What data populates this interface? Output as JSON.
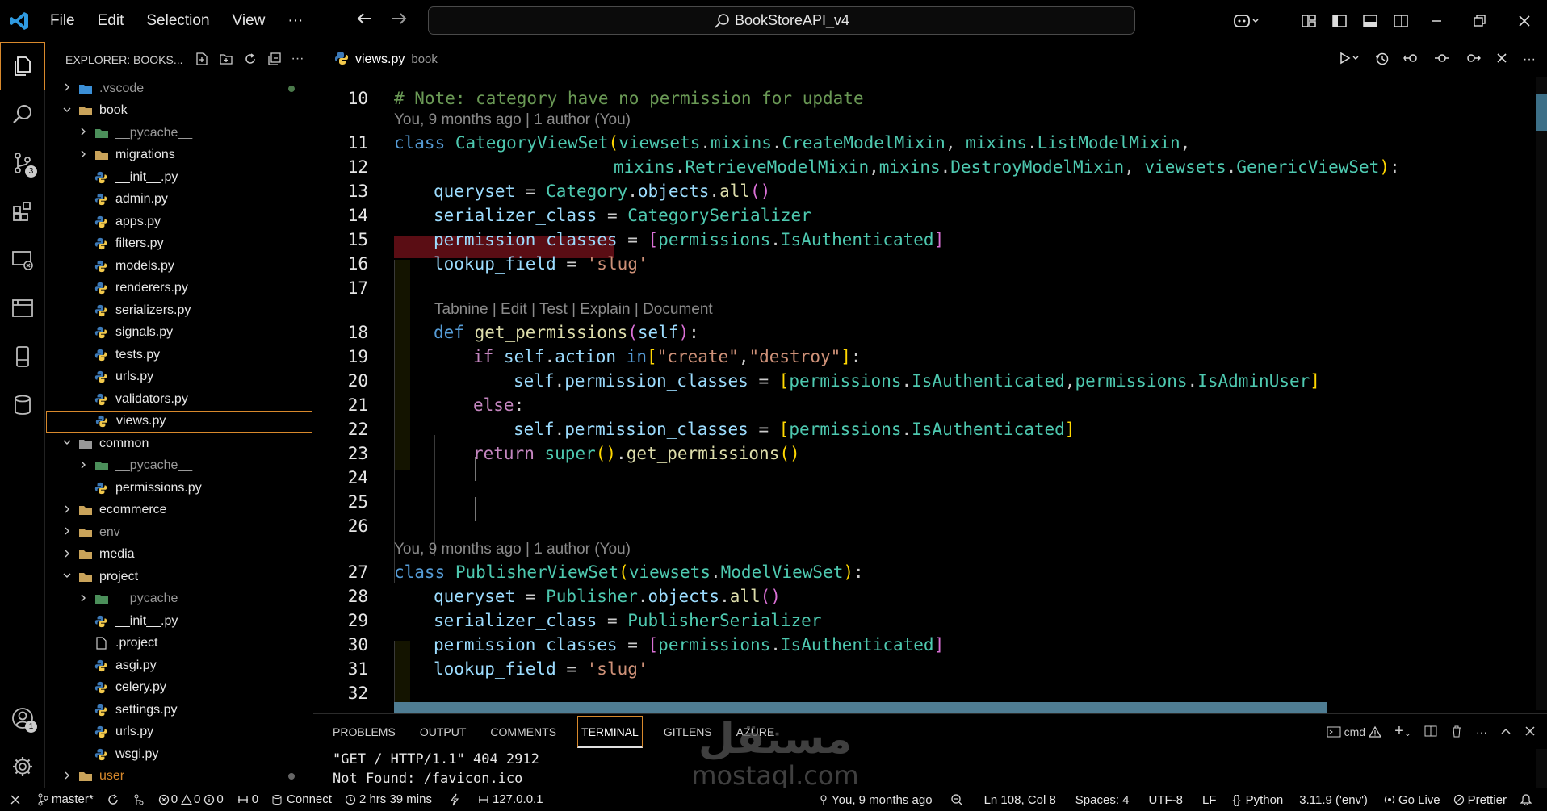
{
  "titlebar": {
    "menu": [
      "File",
      "Edit",
      "Selection",
      "View",
      "···"
    ],
    "search_text": "BookStoreAPI_v4"
  },
  "explorer": {
    "header": "EXPLORER: BOOKS...",
    "items": [
      {
        "label": ".vscode",
        "type": "folder",
        "state": "collapsed",
        "special": "vscode",
        "level": 0
      },
      {
        "label": "book",
        "type": "folder",
        "state": "expanded",
        "level": 0
      },
      {
        "label": "__pycache__",
        "type": "folder",
        "state": "collapsed",
        "special": "pycache",
        "level": 1
      },
      {
        "label": "migrations",
        "type": "folder",
        "state": "collapsed",
        "level": 1
      },
      {
        "label": "__init__.py",
        "type": "python",
        "level": 1
      },
      {
        "label": "admin.py",
        "type": "python",
        "level": 1
      },
      {
        "label": "apps.py",
        "type": "python",
        "level": 1
      },
      {
        "label": "filters.py",
        "type": "python",
        "level": 1
      },
      {
        "label": "models.py",
        "type": "python",
        "level": 1
      },
      {
        "label": "renderers.py",
        "type": "python",
        "level": 1
      },
      {
        "label": "serializers.py",
        "type": "python",
        "level": 1
      },
      {
        "label": "signals.py",
        "type": "python",
        "level": 1
      },
      {
        "label": "tests.py",
        "type": "python",
        "level": 1
      },
      {
        "label": "urls.py",
        "type": "python",
        "level": 1
      },
      {
        "label": "validators.py",
        "type": "python",
        "level": 1
      },
      {
        "label": "views.py",
        "type": "python",
        "level": 1,
        "selected": true
      },
      {
        "label": "common",
        "type": "folder",
        "state": "expanded",
        "special": "common",
        "level": 0
      },
      {
        "label": "__pycache__",
        "type": "folder",
        "state": "collapsed",
        "special": "pycache",
        "level": 1
      },
      {
        "label": "permissions.py",
        "type": "python",
        "level": 1
      },
      {
        "label": "ecommerce",
        "type": "folder",
        "state": "collapsed",
        "level": 0
      },
      {
        "label": "env",
        "type": "folder",
        "state": "collapsed",
        "level": 0,
        "dim": true
      },
      {
        "label": "media",
        "type": "folder",
        "state": "collapsed",
        "level": 0
      },
      {
        "label": "project",
        "type": "folder",
        "state": "expanded",
        "level": 0
      },
      {
        "label": "__pycache__",
        "type": "folder",
        "state": "collapsed",
        "special": "pycache",
        "level": 1
      },
      {
        "label": "__init__.py",
        "type": "python",
        "level": 1
      },
      {
        "label": ".project",
        "type": "file",
        "level": 1
      },
      {
        "label": "asgi.py",
        "type": "python",
        "level": 1
      },
      {
        "label": "celery.py",
        "type": "python",
        "level": 1
      },
      {
        "label": "settings.py",
        "type": "python",
        "level": 1
      },
      {
        "label": "urls.py",
        "type": "python",
        "level": 1
      },
      {
        "label": "wsgi.py",
        "type": "python",
        "level": 1
      },
      {
        "label": "user",
        "type": "folder",
        "state": "collapsed",
        "level": 0,
        "orange": true
      }
    ]
  },
  "editor": {
    "tab_name": "views.py",
    "tab_folder": "book",
    "blame_1": "You, 9 months ago | 1 author (You)",
    "tabnine": "Tabnine | Edit | Test | Explain | Document",
    "blame_2": "You, 9 months ago | 1 author (You)",
    "line_numbers": [
      "10",
      "11",
      "12",
      "13",
      "14",
      "15",
      "16",
      "17",
      "18",
      "19",
      "20",
      "21",
      "22",
      "23",
      "24",
      "25",
      "26",
      "27",
      "28",
      "29",
      "30",
      "31",
      "32"
    ]
  },
  "panel": {
    "tabs": [
      "PROBLEMS",
      "OUTPUT",
      "COMMENTS",
      "TERMINAL",
      "GITLENS",
      "AZURE"
    ],
    "active_tab": "TERMINAL",
    "shell": "cmd",
    "terminal_lines": [
      "\"GET / HTTP/1.1\" 404 2912",
      "Not Found: /favicon.ico"
    ]
  },
  "watermark": {
    "arabic": "مستقل",
    "latin": "mostaql.com"
  },
  "statusbar": {
    "branch": "master*",
    "errors": "0",
    "warnings": "0",
    "info": "0",
    "ports": "0",
    "connect": "Connect",
    "time": "2 hrs 39 mins",
    "host": "127.0.0.1",
    "blame": "You, 9 months ago",
    "position": "Ln 108, Col 8",
    "spaces": "Spaces: 4",
    "encoding": "UTF-8",
    "eol": "LF",
    "language": "Python",
    "interpreter": "3.11.9 ('env')",
    "golive": "Go Live",
    "prettier": "Prettier"
  },
  "activity_badges": {
    "source_control": "3",
    "accounts": "1"
  },
  "colors": {
    "accent": "#d8892c",
    "keyword": "#569cd6",
    "class": "#4ec9b0",
    "string": "#ce9178",
    "comment": "#6a9955"
  }
}
